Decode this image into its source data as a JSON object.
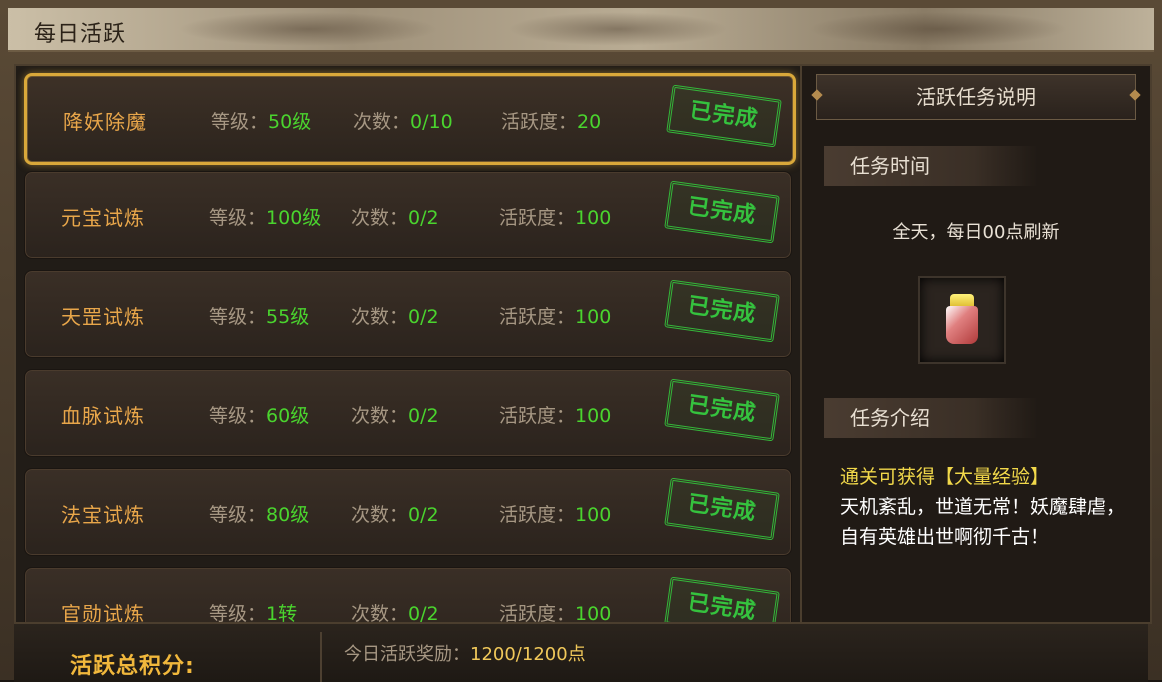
{
  "window": {
    "title": "每日活跃"
  },
  "tasks": [
    {
      "name": "降妖除魔",
      "level_label": "等级：",
      "level": "50级",
      "count_label": "次数：",
      "count": "0/10",
      "activity_label": "活跃度：",
      "activity": "20",
      "status": "已完成"
    },
    {
      "name": "元宝试炼",
      "level_label": "等级：",
      "level": "100级",
      "count_label": "次数：",
      "count": "0/2",
      "activity_label": "活跃度：",
      "activity": "100",
      "status": "已完成"
    },
    {
      "name": "天罡试炼",
      "level_label": "等级：",
      "level": "55级",
      "count_label": "次数：",
      "count": "0/2",
      "activity_label": "活跃度：",
      "activity": "100",
      "status": "已完成"
    },
    {
      "name": "血脉试炼",
      "level_label": "等级：",
      "level": "60级",
      "count_label": "次数：",
      "count": "0/2",
      "activity_label": "活跃度：",
      "activity": "100",
      "status": "已完成"
    },
    {
      "name": "法宝试炼",
      "level_label": "等级：",
      "level": "80级",
      "count_label": "次数：",
      "count": "0/2",
      "activity_label": "活跃度：",
      "activity": "100",
      "status": "已完成"
    },
    {
      "name": "官勋试炼",
      "level_label": "等级：",
      "level": "1转",
      "count_label": "次数：",
      "count": "0/2",
      "activity_label": "活跃度：",
      "activity": "100",
      "status": "已完成"
    }
  ],
  "info_panel": {
    "header": "活跃任务说明",
    "time_section_title": "任务时间",
    "time_text": "全天，每日00点刷新",
    "reward_item_icon": "potion-icon",
    "intro_section_title": "任务介绍",
    "intro_highlight": "通关可获得【大量经验】",
    "intro_body": "天机紊乱，世道无常！妖魔肆虐，自有英雄出世啊彻千古！"
  },
  "bottom": {
    "total_label": "活跃总积分:",
    "reward_label": "今日活跃奖励：",
    "reward_value": "1200/1200点"
  },
  "colors": {
    "selected_border": "#d9a83a",
    "task_name": "#e8a64a",
    "value_green": "#4ad42e",
    "stamp_green": "#35c23e",
    "highlight_yellow": "#f1d84a",
    "total_label_gold": "#f1b83c"
  }
}
